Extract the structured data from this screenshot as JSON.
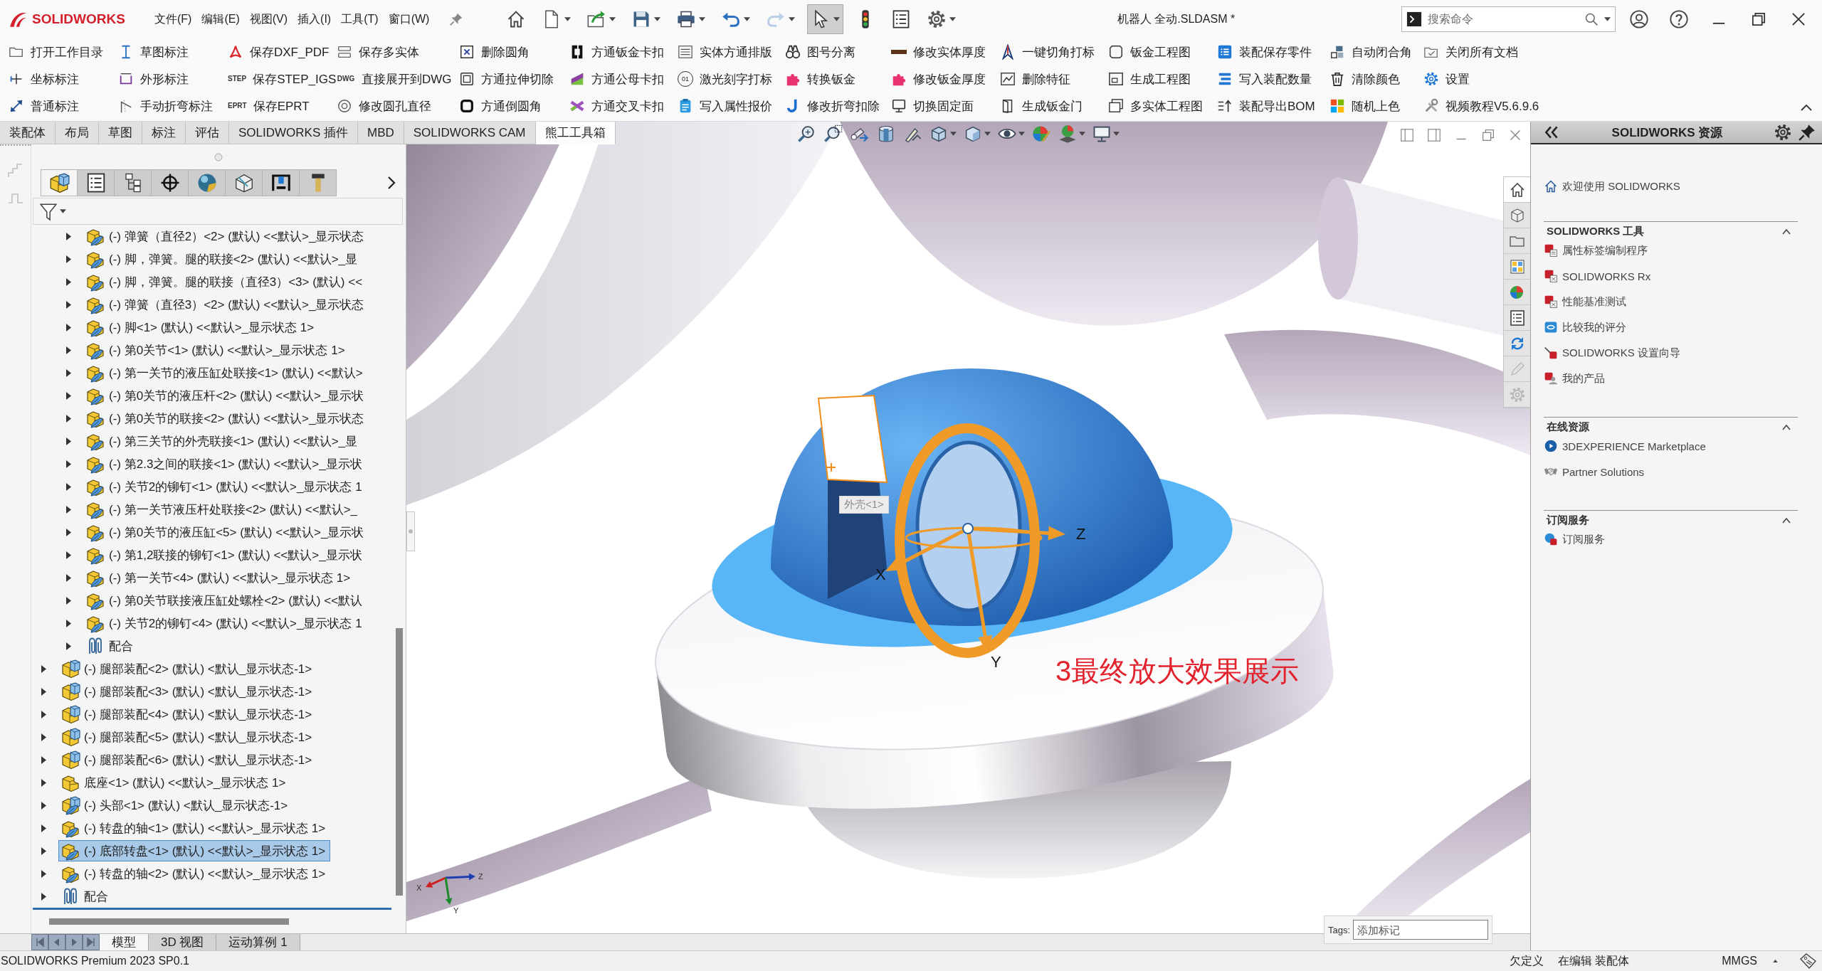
{
  "app": {
    "logo_text": "SOLIDWORKS",
    "menus": [
      "文件(F)",
      "编辑(E)",
      "视图(V)",
      "插入(I)",
      "工具(T)",
      "窗口(W)"
    ],
    "quick_access": [
      {
        "kind": "home",
        "dropdown": false,
        "pressed": false,
        "disabled": false
      },
      {
        "kind": "new",
        "dropdown": true,
        "pressed": false,
        "disabled": false
      },
      {
        "kind": "open",
        "dropdown": true,
        "pressed": false,
        "disabled": false
      },
      {
        "kind": "save",
        "dropdown": true,
        "pressed": false,
        "disabled": false
      },
      {
        "kind": "print",
        "dropdown": true,
        "pressed": false,
        "disabled": false
      },
      {
        "kind": "undo",
        "dropdown": true,
        "pressed": false,
        "disabled": false
      },
      {
        "kind": "redo",
        "dropdown": true,
        "pressed": false,
        "disabled": true
      },
      {
        "kind": "select",
        "dropdown": true,
        "pressed": true,
        "disabled": false
      },
      {
        "kind": "rebuild",
        "dropdown": false,
        "pressed": false,
        "disabled": false
      },
      {
        "kind": "file_properties",
        "dropdown": false,
        "pressed": false,
        "disabled": false
      },
      {
        "kind": "options",
        "dropdown": true,
        "pressed": false,
        "disabled": false
      }
    ],
    "document_title": "机器人 全动.SLDASM *",
    "search": {
      "placeholder": "搜索命令"
    }
  },
  "command_manager": {
    "columns": [
      [
        {
          "label": "打开工作目录",
          "kind": "folder"
        },
        {
          "label": "坐标标注",
          "kind": "ordinate"
        },
        {
          "label": "普通标注",
          "kind": "dimension"
        }
      ],
      [
        {
          "label": "草图标注",
          "kind": "vertical_dimension"
        },
        {
          "label": "外形标注",
          "kind": "frame_dimension"
        },
        {
          "label": "手动折弯标注",
          "kind": "bend_note"
        }
      ],
      [
        {
          "label": "保存DXF_PDF",
          "kind": "pdf"
        },
        {
          "label": "保存STEP_IGS",
          "kind": "file_type",
          "icon_text": "STEP"
        },
        {
          "label": "保存EPRT",
          "kind": "file_type",
          "icon_text": "EPRT"
        }
      ],
      [
        {
          "label": "保存多实体",
          "kind": "stack"
        },
        {
          "label": "直接展开到DWG",
          "kind": "file_type",
          "icon_text": "DWG"
        },
        {
          "label": "修改圆孔直径",
          "kind": "hole"
        }
      ],
      [
        {
          "label": "删除圆角",
          "kind": "cross_box"
        },
        {
          "label": "方通拉伸切除",
          "kind": "nested_square"
        },
        {
          "label": "方通倒圆角",
          "kind": "rounded_square"
        }
      ],
      [
        {
          "label": "方通钣金卡扣",
          "kind": "clip"
        },
        {
          "label": "方通公母卡扣",
          "kind": "color_block"
        },
        {
          "label": "方通交叉卡扣",
          "kind": "crossed_bars"
        }
      ],
      [
        {
          "label": "实体方通排版",
          "kind": "lines"
        },
        {
          "label": "激光刻字打标",
          "kind": "circled_text",
          "icon_text": "01"
        },
        {
          "label": "写入属性报价",
          "kind": "clipboard"
        }
      ],
      [
        {
          "label": "图号分离",
          "kind": "binoculars"
        },
        {
          "label": "转换钣金",
          "kind": "puzzle"
        },
        {
          "label": "修改折弯扣除",
          "kind": "hook"
        }
      ],
      [
        {
          "label": "修改实体厚度",
          "kind": "thick_bar"
        },
        {
          "label": "修改钣金厚度",
          "kind": "puzzle"
        },
        {
          "label": "切换固定面",
          "kind": "monitor"
        }
      ],
      [
        {
          "label": "一键切角打标",
          "kind": "compass"
        },
        {
          "label": "删除特征",
          "kind": "line_chart"
        },
        {
          "label": "生成钣金门",
          "kind": "book"
        }
      ],
      [
        {
          "label": "钣金工程图",
          "kind": "frame"
        },
        {
          "label": "生成工程图",
          "kind": "sheet"
        },
        {
          "label": "多实体工程图",
          "kind": "sheets"
        }
      ],
      [
        {
          "label": "装配保存零件",
          "kind": "bulleted_list"
        },
        {
          "label": "写入装配数量",
          "kind": "layers"
        },
        {
          "label": "装配导出BOM",
          "kind": "list_arrow"
        }
      ],
      [
        {
          "label": "自动闭合角",
          "kind": "blocks"
        },
        {
          "label": "清除颜色",
          "kind": "trash"
        },
        {
          "label": "随机上色",
          "kind": "four_squares"
        }
      ],
      [
        {
          "label": "关闭所有文档",
          "kind": "folder_check"
        },
        {
          "label": "设置",
          "kind": "gear"
        },
        {
          "label": "视频教程V5.6.9.6",
          "kind": "tools"
        }
      ]
    ]
  },
  "command_tabs": [
    {
      "label": "装配体",
      "selected": false
    },
    {
      "label": "布局",
      "selected": false
    },
    {
      "label": "草图",
      "selected": false
    },
    {
      "label": "标注",
      "selected": false
    },
    {
      "label": "评估",
      "selected": false
    },
    {
      "label": "SOLIDWORKS 插件",
      "selected": false
    },
    {
      "label": "MBD",
      "selected": false
    },
    {
      "label": "SOLIDWORKS CAM",
      "selected": false
    },
    {
      "label": "熊工工具箱",
      "selected": true
    }
  ],
  "feature_manager": {
    "panel_tabs": [
      {
        "kind": "feature_tree",
        "selected": true
      },
      {
        "kind": "properties",
        "selected": false
      },
      {
        "kind": "configurations",
        "selected": false
      },
      {
        "kind": "dimxpert",
        "selected": false
      },
      {
        "kind": "display",
        "selected": false
      },
      {
        "kind": "cam_features",
        "selected": false
      },
      {
        "kind": "cam_operations",
        "selected": false
      },
      {
        "kind": "cam_tools",
        "selected": false
      }
    ],
    "tree": {
      "hidden_parent": {
        "children": [
          {
            "label": "(-) 弹簧（直径2）<2> (默认) <<默认>_显示状态",
            "kind": "light_part",
            "expanded": false,
            "selected": false
          },
          {
            "label": "(-) 脚，弹簧。腿的联接<2> (默认) <<默认>_显",
            "kind": "light_part",
            "expanded": false,
            "selected": false
          },
          {
            "label": "(-) 脚，弹簧。腿的联接（直径3）<3> (默认) <<",
            "kind": "light_part",
            "expanded": false,
            "selected": false
          },
          {
            "label": "(-) 弹簧（直径3）<2> (默认) <<默认>_显示状态",
            "kind": "light_part",
            "expanded": false,
            "selected": false
          },
          {
            "label": "(-) 脚<1> (默认) <<默认>_显示状态 1>",
            "kind": "light_part",
            "expanded": false,
            "selected": false
          },
          {
            "label": "(-) 第0关节<1> (默认) <<默认>_显示状态 1>",
            "kind": "light_part",
            "expanded": false,
            "selected": false
          },
          {
            "label": "(-) 第一关节的液压缸处联接<1> (默认) <<默认>",
            "kind": "light_part",
            "expanded": false,
            "selected": false
          },
          {
            "label": "(-) 第0关节的液压杆<2> (默认) <<默认>_显示状",
            "kind": "light_part",
            "expanded": false,
            "selected": false
          },
          {
            "label": "(-) 第0关节的联接<2> (默认) <<默认>_显示状态",
            "kind": "light_part",
            "expanded": false,
            "selected": false
          },
          {
            "label": "(-) 第三关节的外壳联接<1> (默认) <<默认>_显",
            "kind": "light_part",
            "expanded": false,
            "selected": false
          },
          {
            "label": "(-) 第2.3之间的联接<1> (默认) <<默认>_显示状",
            "kind": "light_part",
            "expanded": false,
            "selected": false
          },
          {
            "label": "(-) 关节2的铆钉<1> (默认) <<默认>_显示状态 1",
            "kind": "light_part",
            "expanded": false,
            "selected": false
          },
          {
            "label": "(-) 第一关节液压杆处联接<2> (默认) <<默认>_",
            "kind": "light_part",
            "expanded": false,
            "selected": false
          },
          {
            "label": "(-) 第0关节的液压缸<5> (默认) <<默认>_显示状",
            "kind": "light_part",
            "expanded": false,
            "selected": false
          },
          {
            "label": "(-) 第1,2联接的铆钉<1> (默认) <<默认>_显示状",
            "kind": "light_part",
            "expanded": false,
            "selected": false
          },
          {
            "label": "(-) 第一关节<4> (默认) <<默认>_显示状态 1>",
            "kind": "light_part",
            "expanded": false,
            "selected": false
          },
          {
            "label": "(-) 第0关节联接液压缸处螺栓<2> (默认) <<默认",
            "kind": "light_part",
            "expanded": false,
            "selected": false
          },
          {
            "label": "(-) 关节2的铆钉<4> (默认) <<默认>_显示状态 1",
            "kind": "light_part",
            "expanded": false,
            "selected": false
          },
          {
            "label": "配合",
            "kind": "mates",
            "expanded": false,
            "selected": false
          }
        ]
      },
      "items": [
        {
          "label": "(-) 腿部装配<2> (默认) <默认_显示状态-1>",
          "kind": "assembly",
          "expanded": false,
          "selected": false
        },
        {
          "label": "(-) 腿部装配<3> (默认) <默认_显示状态-1>",
          "kind": "assembly",
          "expanded": false,
          "selected": false
        },
        {
          "label": "(-) 腿部装配<4> (默认) <默认_显示状态-1>",
          "kind": "assembly",
          "expanded": false,
          "selected": false
        },
        {
          "label": "(-) 腿部装配<5> (默认) <默认_显示状态-1>",
          "kind": "assembly",
          "expanded": false,
          "selected": false
        },
        {
          "label": "(-) 腿部装配<6> (默认) <默认_显示状态-1>",
          "kind": "assembly",
          "expanded": false,
          "selected": false
        },
        {
          "label": "底座<1> (默认) <<默认>_显示状态 1>",
          "kind": "part",
          "expanded": false,
          "selected": false
        },
        {
          "label": "(-) 头部<1> (默认) <默认_显示状态-1>",
          "kind": "light_assembly",
          "expanded": false,
          "selected": false
        },
        {
          "label": "(-) 转盘的轴<1> (默认) <<默认>_显示状态 1>",
          "kind": "light_part",
          "expanded": false,
          "selected": false
        },
        {
          "label": "(-) 底部转盘<1> (默认) <<默认>_显示状态 1>",
          "kind": "light_part",
          "expanded": false,
          "selected": true
        },
        {
          "label": "(-) 转盘的轴<2> (默认) <<默认>_显示状态 1>",
          "kind": "light_part",
          "expanded": false,
          "selected": false
        },
        {
          "label": "配合",
          "kind": "mates",
          "expanded": false,
          "selected": false
        }
      ]
    }
  },
  "bottom_tabs": [
    {
      "label": "模型",
      "selected": true
    },
    {
      "label": "3D 视图",
      "selected": false
    },
    {
      "label": "运动算例 1",
      "selected": false
    }
  ],
  "viewport": {
    "view_toolbar": [
      {
        "kind": "zoom_fit",
        "dropdown": false
      },
      {
        "kind": "zoom_area",
        "dropdown": false
      },
      {
        "kind": "previous_view",
        "dropdown": false
      },
      {
        "kind": "section_view",
        "dropdown": false
      },
      {
        "kind": "annotations",
        "dropdown": false
      },
      {
        "kind": "view_orientation",
        "dropdown": true
      },
      {
        "kind": "display_style",
        "dropdown": true
      },
      {
        "kind": "hide_show",
        "dropdown": true
      },
      {
        "kind": "appearance",
        "dropdown": false
      },
      {
        "kind": "scene",
        "dropdown": true
      },
      {
        "kind": "view_settings",
        "dropdown": true
      }
    ],
    "tooltip": "外壳<1>",
    "triad_labels": {
      "x": "X",
      "y": "Y",
      "z": "Z"
    },
    "annotation": "3最终放大效果展示",
    "orientation_triad_labels": {
      "x": "X",
      "y": "Y",
      "z": "Z"
    },
    "tags": {
      "label": "Tags:",
      "placeholder": "添加标记"
    }
  },
  "task_pane": {
    "tabs": [
      {
        "kind": "resources",
        "selected": true,
        "disabled": false
      },
      {
        "kind": "design_library",
        "selected": false,
        "disabled": false
      },
      {
        "kind": "file_explorer",
        "selected": false,
        "disabled": false
      },
      {
        "kind": "view_palette",
        "selected": false,
        "disabled": false
      },
      {
        "kind": "appearances",
        "selected": false,
        "disabled": false
      },
      {
        "kind": "custom_properties",
        "selected": false,
        "disabled": false
      },
      {
        "kind": "forum",
        "selected": false,
        "disabled": false
      },
      {
        "kind": "pencil",
        "selected": false,
        "disabled": true
      },
      {
        "kind": "settings",
        "selected": false,
        "disabled": true
      }
    ],
    "title": "SOLIDWORKS 资源",
    "welcome": "欢迎使用 SOLIDWORKS",
    "sections": [
      {
        "title": "SOLIDWORKS 工具",
        "expanded": true,
        "items": [
          {
            "label": "属性标签编制程序",
            "kind": "cube_sheet"
          },
          {
            "label": "SOLIDWORKS Rx",
            "kind": "cube_card"
          },
          {
            "label": "性能基准测试",
            "kind": "cube_card"
          },
          {
            "label": "比较我的评分",
            "kind": "eye_tile"
          },
          {
            "label": "SOLIDWORKS 设置向导",
            "kind": "wand_cube"
          },
          {
            "label": "我的产品",
            "kind": "cube_person"
          }
        ]
      },
      {
        "title": "在线资源",
        "expanded": true,
        "items": [
          {
            "label": "3DEXPERIENCE Marketplace",
            "kind": "play_globe"
          },
          {
            "label": "Partner Solutions",
            "kind": "handshake"
          }
        ]
      },
      {
        "title": "订阅服务",
        "expanded": true,
        "items": [
          {
            "label": "订阅服务",
            "kind": "globe_cube"
          }
        ]
      }
    ]
  },
  "status_bar": {
    "product": "SOLIDWORKS Premium 2023 SP0.1",
    "definition": "欠定义",
    "mode": "在编辑 装配体",
    "units": "MMGS"
  }
}
